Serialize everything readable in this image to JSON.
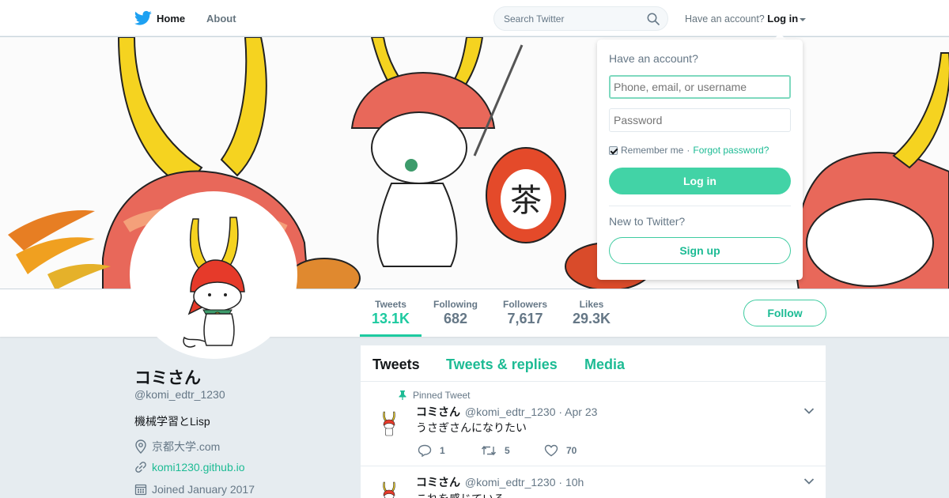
{
  "nav": {
    "home_label": "Home",
    "about_label": "About",
    "search_placeholder": "Search Twitter",
    "have_account_text": "Have an account?",
    "login_label": "Log in"
  },
  "profile": {
    "name": "コミさん",
    "handle": "@komi_edtr_1230",
    "bio": "機械学習とLisp",
    "location": "京都大学.com",
    "website": "komi1230.github.io",
    "joined": "Joined January 2017"
  },
  "stats": [
    {
      "label": "Tweets",
      "value": "13.1K",
      "active": true
    },
    {
      "label": "Following",
      "value": "682",
      "active": false
    },
    {
      "label": "Followers",
      "value": "7,617",
      "active": false
    },
    {
      "label": "Likes",
      "value": "29.3K",
      "active": false
    }
  ],
  "follow_label": "Follow",
  "timeline": {
    "tabs": [
      "Tweets",
      "Tweets & replies",
      "Media"
    ],
    "tweets": [
      {
        "pinned_label": "Pinned Tweet",
        "name": "コミさん",
        "handle": "@komi_edtr_1230",
        "time": "· Apr 23",
        "text": "うさぎさんになりたい",
        "replies": "1",
        "retweets": "5",
        "likes": "70"
      },
      {
        "name": "コミさん",
        "handle": "@komi_edtr_1230",
        "time": "· 10h",
        "text": "これを感じている"
      }
    ]
  },
  "login_dropdown": {
    "title": "Have an account?",
    "username_placeholder": "Phone, email, or username",
    "password_placeholder": "Password",
    "remember_label": "Remember me",
    "separator": "·",
    "forgot_label": "Forgot password?",
    "login_button": "Log in",
    "new_to_twitter": "New to Twitter?",
    "signup_button": "Sign up"
  },
  "colors": {
    "accent": "#1dbb94",
    "twitter_blue": "#1da1f2",
    "background": "#e6ecf0"
  }
}
